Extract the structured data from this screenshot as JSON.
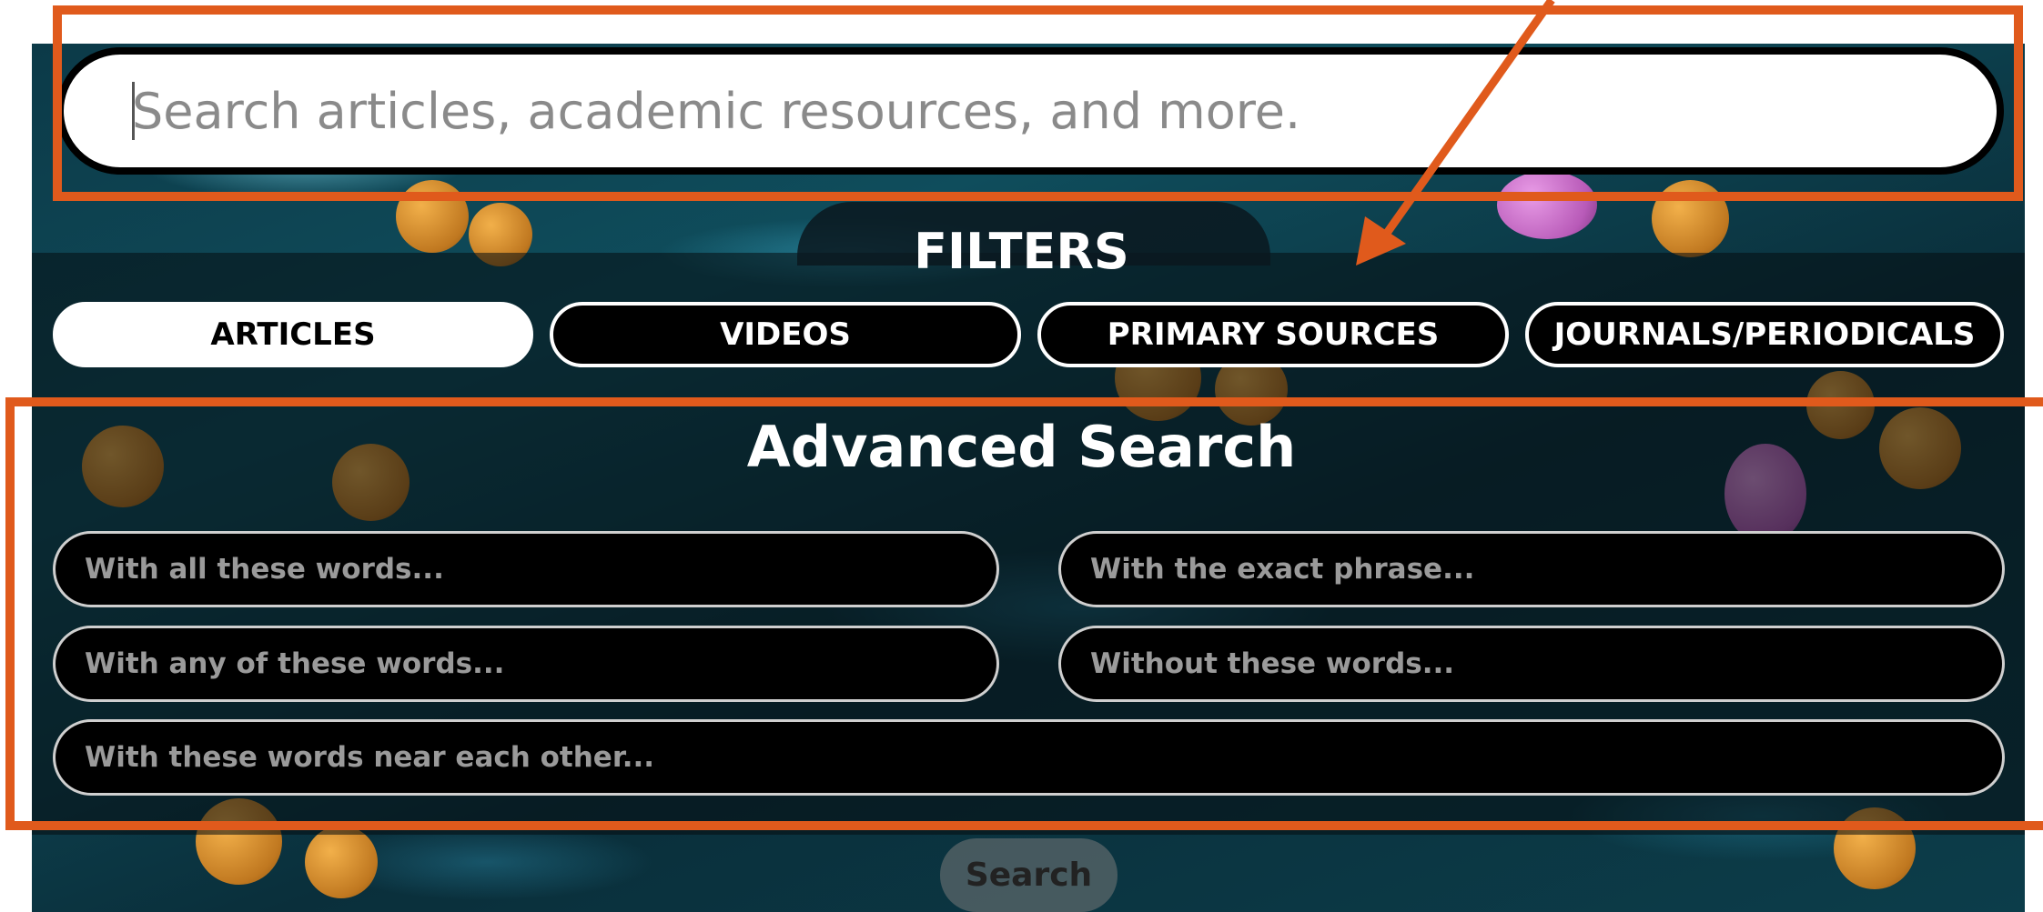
{
  "search": {
    "placeholder": "Search articles, academic resources, and more."
  },
  "filters": {
    "title": "FILTERS",
    "buttons": [
      {
        "label": "ARTICLES",
        "active": true
      },
      {
        "label": "VIDEOS",
        "active": false
      },
      {
        "label": "PRIMARY SOURCES",
        "active": false
      },
      {
        "label": "JOURNALS/PERIODICALS",
        "active": false
      }
    ]
  },
  "advanced": {
    "title": "Advanced Search",
    "fields": [
      {
        "placeholder": "With all these words..."
      },
      {
        "placeholder": "With the exact phrase..."
      },
      {
        "placeholder": "With any of these words..."
      },
      {
        "placeholder": "Without these words..."
      },
      {
        "placeholder": "With these words near each other..."
      }
    ],
    "submit_label": "Search"
  },
  "colors": {
    "annotation": "#e05a1c",
    "active_filter_bg": "#ffffff",
    "inactive_filter_bg": "#000000"
  }
}
